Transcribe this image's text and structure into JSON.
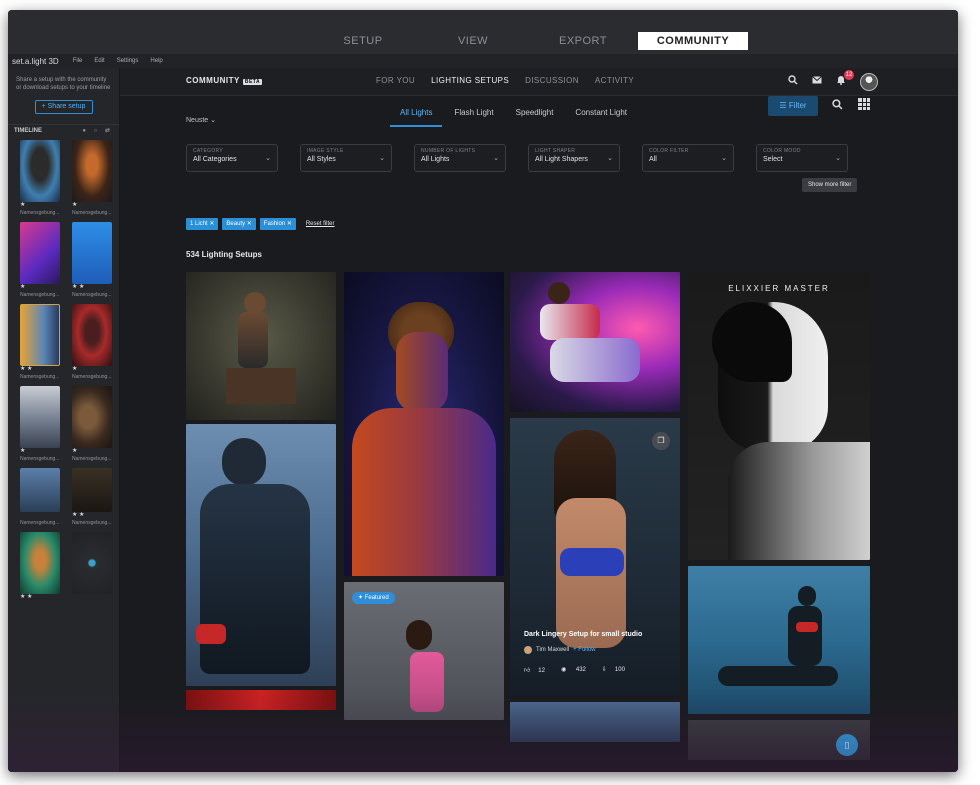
{
  "app": {
    "name": "set.a.light 3D",
    "menu": [
      "File",
      "Edit",
      "Settings",
      "Help"
    ]
  },
  "main_tabs": [
    {
      "label": "SETUP",
      "active": false
    },
    {
      "label": "VIEW",
      "active": false
    },
    {
      "label": "EXPORT",
      "active": false
    },
    {
      "label": "COMMUNITY",
      "active": true
    }
  ],
  "sidebar": {
    "share_text": "Share a setup with the community or download setups to your timeline",
    "share_button": "+ Share setup",
    "timeline_title": "TIMELINE",
    "thumbs": [
      {
        "dots": "★",
        "label": "Namensgebung..."
      },
      {
        "dots": "★",
        "label": "Namensgebung..."
      },
      {
        "dots": "★",
        "label": "Namensgebung..."
      },
      {
        "dots": "★ ★",
        "label": "Namensgebung..."
      },
      {
        "dots": "★ ★",
        "label": "Namensgebung..."
      },
      {
        "dots": "★",
        "label": "Namensgebung..."
      },
      {
        "dots": "★",
        "label": "Namensgebung..."
      },
      {
        "dots": "★",
        "label": "Namensgebung..."
      },
      {
        "dots": "",
        "label": "Namensgebung..."
      },
      {
        "dots": "★ ★",
        "label": "Namensgebung..."
      },
      {
        "dots": "★ ★",
        "label": ""
      },
      {
        "dots": "",
        "label": ""
      }
    ]
  },
  "community": {
    "label": "COMMUNITY",
    "beta": "BETA",
    "tabs": [
      {
        "label": "FOR YOU",
        "active": false
      },
      {
        "label": "LIGHTING SETUPS",
        "active": true
      },
      {
        "label": "DISCUSSION",
        "active": false
      },
      {
        "label": "ACTIVITY",
        "active": false
      }
    ],
    "notifications": "12"
  },
  "filters": {
    "sort": "Neuste",
    "light_tabs": [
      {
        "label": "All Lights",
        "active": true
      },
      {
        "label": "Flash Light",
        "active": false
      },
      {
        "label": "Speedlight",
        "active": false
      },
      {
        "label": "Constant Light",
        "active": false
      }
    ],
    "filter_button": "Filter",
    "selects": [
      {
        "caption": "CATEGORY",
        "value": "All Categories"
      },
      {
        "caption": "IMAGE STYLE",
        "value": "All Styles"
      },
      {
        "caption": "NUMBER OF LIGHTS",
        "value": "All Lights"
      },
      {
        "caption": "LIGHT SHAPER",
        "value": "All Light Shapers"
      },
      {
        "caption": "COLOR FILTER",
        "value": "All"
      },
      {
        "caption": "COLOR MOOD",
        "value": "Select"
      }
    ],
    "show_more": "Show more filter",
    "chips": [
      "1 Licht",
      "Beauty",
      "Fashion"
    ],
    "reset": "Reset filter"
  },
  "results": {
    "count_label": "534 Lighting Setups"
  },
  "cards": {
    "featured_badge": "Featured",
    "elixxier_title": "ELIXXIER MASTER",
    "highlight": {
      "title": "Dark Lingery Setup for small studio",
      "author": "Tim Maxwell",
      "follow": "Follow",
      "likes": "12",
      "views": "432",
      "downloads": "100"
    }
  },
  "colors": {
    "accent": "#2e8fd8",
    "background": "#1a1b1e",
    "sidebar": "#25262a"
  }
}
